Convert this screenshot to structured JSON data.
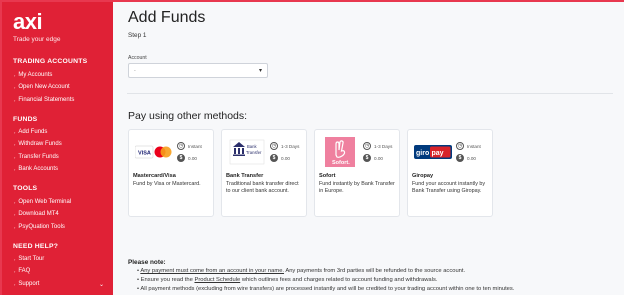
{
  "brand": {
    "logo": "axi",
    "tagline": "Trade your edge"
  },
  "sidebar": {
    "sections": [
      {
        "title": "TRADING ACCOUNTS",
        "items": [
          "My Accounts",
          "Open New Account",
          "Financial Statements"
        ]
      },
      {
        "title": "FUNDS",
        "items": [
          "Add Funds",
          "Withdraw Funds",
          "Transfer Funds",
          "Bank Accounts"
        ]
      },
      {
        "title": "TOOLS",
        "items": [
          "Open Web Terminal",
          "Download MT4",
          "PsyQuation Tools"
        ]
      },
      {
        "title": "NEED HELP?",
        "items": [
          "Start Tour",
          "FAQ",
          "Support"
        ]
      }
    ]
  },
  "main": {
    "title": "Add Funds",
    "step": "Step 1",
    "account_label": "Account",
    "account_value": "- ",
    "pay_title": "Pay using other methods:",
    "methods": [
      {
        "name": "Mastercard/Visa",
        "time": "Instant",
        "fee": "0.00",
        "desc": "Fund by Visa or Mastercard.",
        "logo_text": "VISA",
        "logo_color": "#1a1f71"
      },
      {
        "name": "Bank Transfer",
        "time": "1-3 Days",
        "fee": "0.00",
        "desc": "Traditional bank transfer direct to our client bank account.",
        "logo_text": "Bank Transfer",
        "logo_color": "#2b2f6b"
      },
      {
        "name": "Sofort",
        "time": "1-3 Days",
        "fee": "0.00",
        "desc": "Fund instantly by Bank Transfer in Europe.",
        "logo_text": "Sofort.",
        "logo_color": "#ef809f"
      },
      {
        "name": "Giropay",
        "time": "Instant",
        "fee": "0.00",
        "desc": "Fund your account instantly by Bank Transfer using Giropay.",
        "logo_text": "giropay",
        "logo_color": "#003a7d"
      }
    ],
    "note": {
      "title": "Please note:",
      "l1a": "Any payment must come from an account in your name.",
      "l1b": " Any payments from 3rd parties will be refunded to the source account.",
      "l2a": "Ensure you read the ",
      "l2b": "Product Schedule",
      "l2c": " which outlines fees and charges related to account funding and withdrawals.",
      "l3": "All payment methods (excluding from wire transfers) are processed instantly and will be credited to your trading account within one to ten minutes."
    }
  }
}
